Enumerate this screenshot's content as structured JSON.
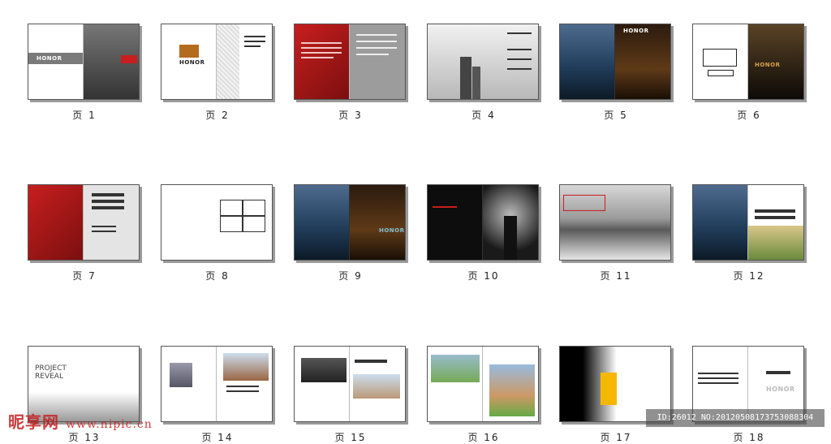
{
  "pages": [
    {
      "label": "页 1"
    },
    {
      "label": "页 2"
    },
    {
      "label": "页 3"
    },
    {
      "label": "页 4"
    },
    {
      "label": "页 5"
    },
    {
      "label": "页 6"
    },
    {
      "label": "页 7"
    },
    {
      "label": "页 8"
    },
    {
      "label": "页 9"
    },
    {
      "label": "页 10"
    },
    {
      "label": "页 11"
    },
    {
      "label": "页 12"
    },
    {
      "label": "页 13"
    },
    {
      "label": "页 14"
    },
    {
      "label": "页 15"
    },
    {
      "label": "页 16"
    },
    {
      "label": "页 17"
    },
    {
      "label": "页 18"
    }
  ],
  "thumb_text": {
    "honor": "HONOR",
    "project_reveal_1": "PROJECT",
    "project_reveal_2": "REVEAL"
  },
  "watermark": {
    "site_cn": "昵享网",
    "site_url": "www.nipic.cn"
  },
  "id_bar": "ID:26012 NO:20120508173753088304",
  "colors": {
    "accent_red": "#c81e1e",
    "accent_yellow": "#f5b800"
  }
}
